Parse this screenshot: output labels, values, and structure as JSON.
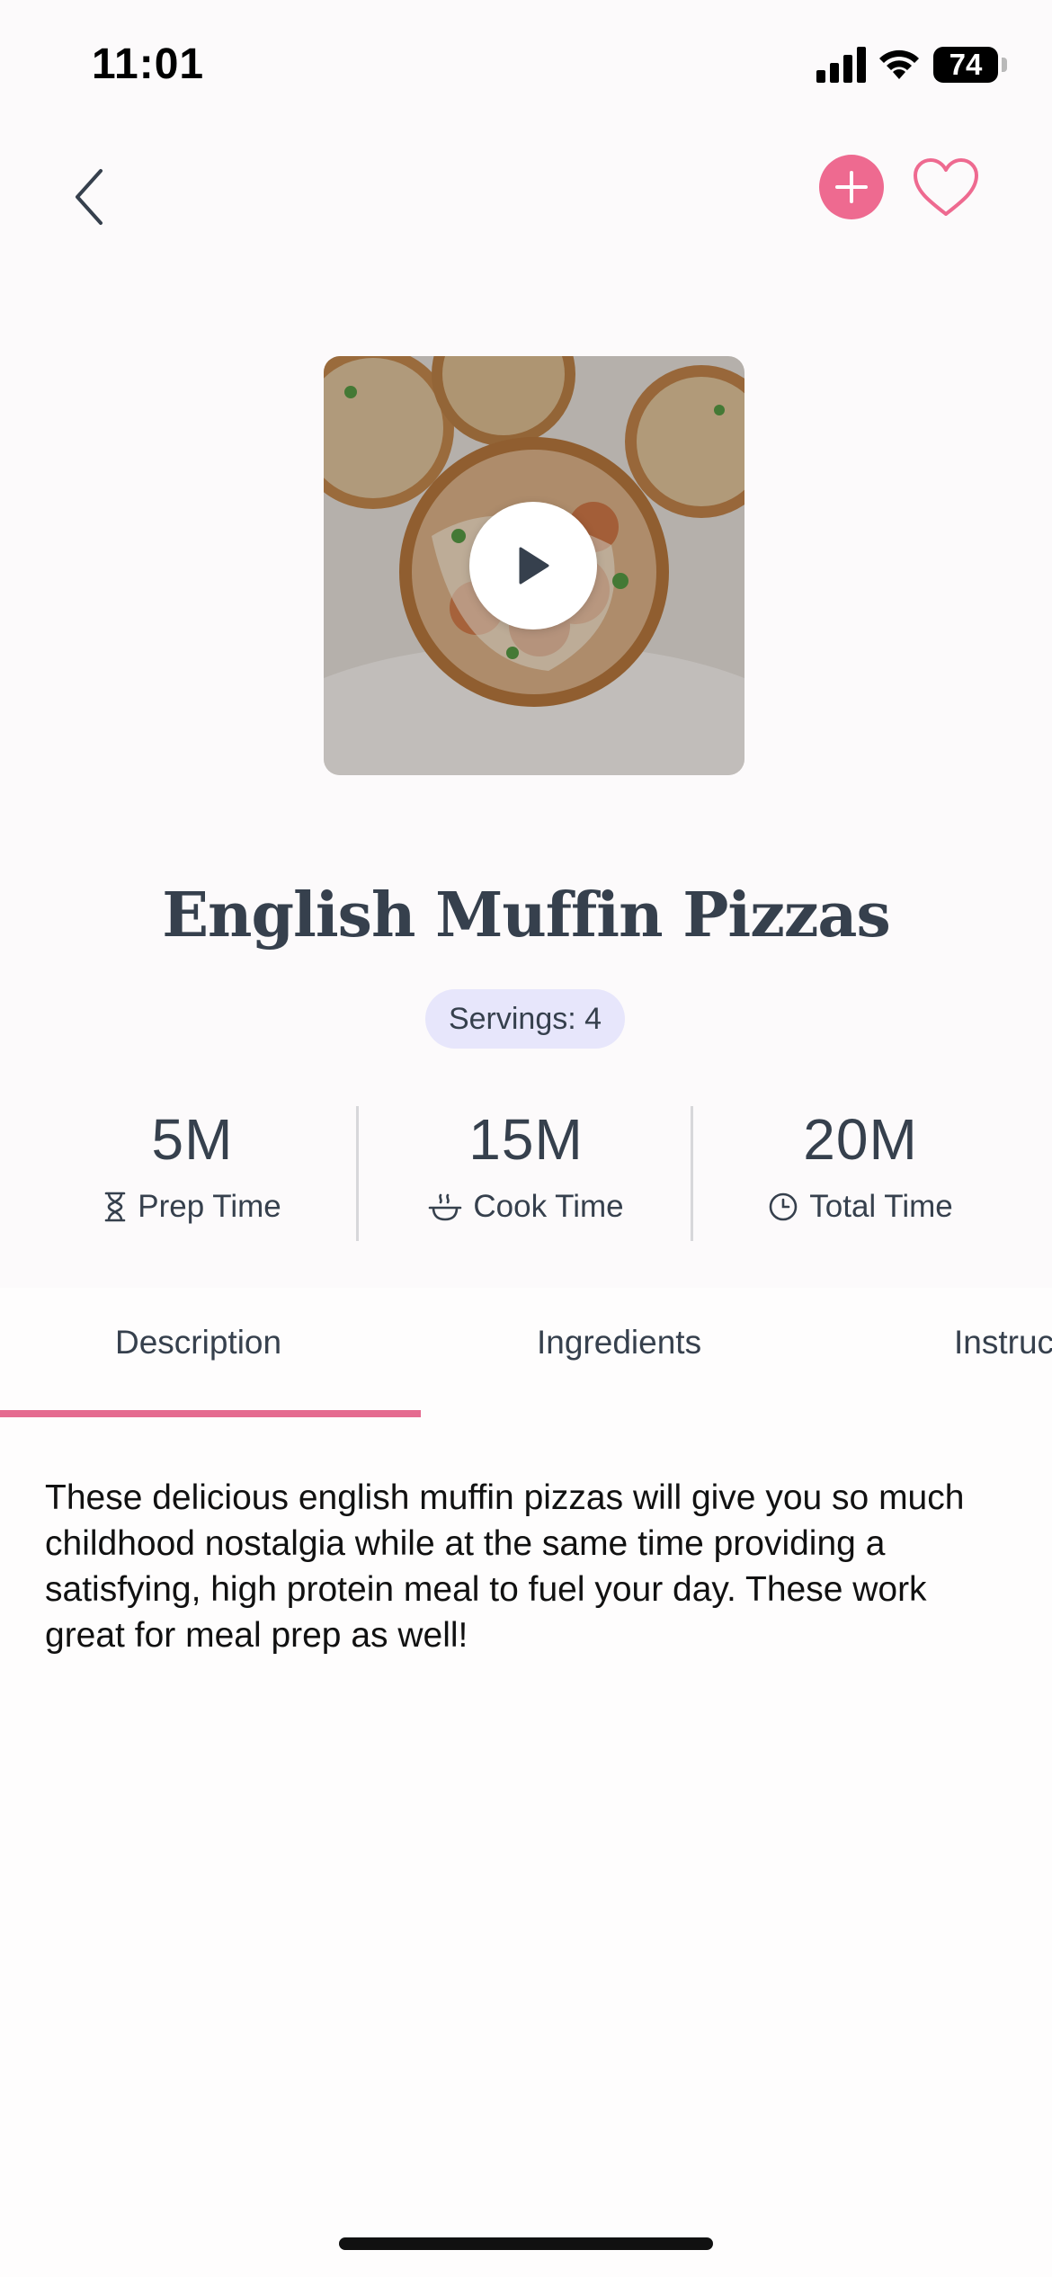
{
  "status_bar": {
    "time": "11:01",
    "battery": "74"
  },
  "header": {
    "back_icon": "chevron-left-icon",
    "add_icon": "plus-icon",
    "favorite_icon": "heart-outline-icon",
    "accent_color": "#ee6a90"
  },
  "media": {
    "play_icon": "play-icon"
  },
  "recipe": {
    "title": "English Muffin Pizzas",
    "servings": "Servings: 4"
  },
  "times": [
    {
      "value": "5M",
      "label": "Prep Time",
      "icon": "hourglass-icon"
    },
    {
      "value": "15M",
      "label": "Cook Time",
      "icon": "cooking-pot-icon"
    },
    {
      "value": "20M",
      "label": "Total Time",
      "icon": "clock-icon"
    }
  ],
  "tabs": [
    {
      "label": "Description",
      "active": true
    },
    {
      "label": "Ingredients",
      "active": false
    },
    {
      "label": "Instructions",
      "active": false
    }
  ],
  "description": "These delicious english muffin pizzas will give you so much childhood nostalgia while at the same time providing a satisfying, high protein meal to fuel your day. These work great for meal prep as well!"
}
